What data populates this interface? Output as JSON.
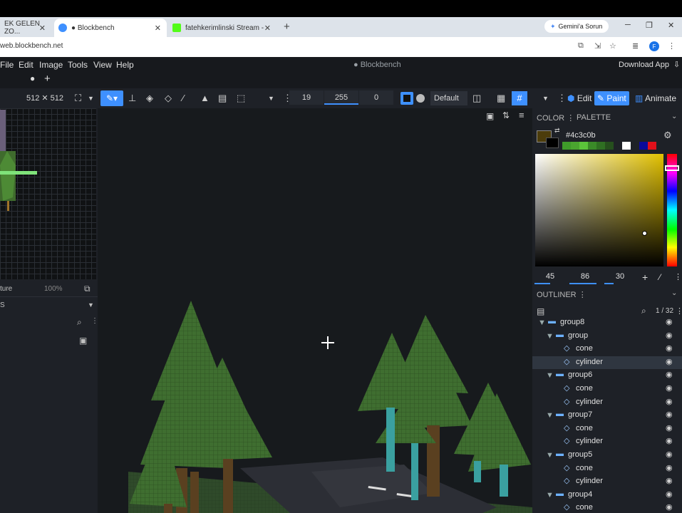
{
  "browser": {
    "tabs": [
      {
        "label": "EK GELEN ZO..."
      },
      {
        "label": "● Blockbench"
      },
      {
        "label": "fatehkerimlinski Stream - Watch"
      }
    ],
    "gemini_label": "Gemini'a Sorun",
    "url": "web.blockbench.net"
  },
  "app": {
    "menu": [
      "File",
      "Edit",
      "Image",
      "Tools",
      "View",
      "Help"
    ],
    "title": "● Blockbench",
    "download_label": "Download App"
  },
  "toolbar": {
    "texture_size": "512 ✕ 512",
    "brush_size": "19",
    "opacity": "255",
    "softness": "0",
    "blend_mode": "Default",
    "modes": [
      "Edit",
      "Paint",
      "Animate"
    ]
  },
  "left_panel": {
    "texture_label": "ture",
    "zoom": "100%",
    "section_label": "S"
  },
  "color_panel": {
    "tab_color": "COLOR",
    "tab_palette": "PALETTE",
    "hex": "#4c3c0b",
    "h": "45",
    "s": "86",
    "v": "30",
    "current_color": "#4c3c0b"
  },
  "outliner": {
    "title": "OUTLINER",
    "count": "1 / 32",
    "rows": [
      {
        "label": "group8",
        "type": "group",
        "indent": 0
      },
      {
        "label": "group",
        "type": "group",
        "indent": 1
      },
      {
        "label": "cone",
        "type": "mesh",
        "indent": 2
      },
      {
        "label": "cylinder",
        "type": "mesh",
        "indent": 2,
        "selected": true
      },
      {
        "label": "group6",
        "type": "group",
        "indent": 1
      },
      {
        "label": "cone",
        "type": "mesh",
        "indent": 2
      },
      {
        "label": "cylinder",
        "type": "mesh",
        "indent": 2
      },
      {
        "label": "group7",
        "type": "group",
        "indent": 1
      },
      {
        "label": "cone",
        "type": "mesh",
        "indent": 2
      },
      {
        "label": "cylinder",
        "type": "mesh",
        "indent": 2
      },
      {
        "label": "group5",
        "type": "group",
        "indent": 1
      },
      {
        "label": "cone",
        "type": "mesh",
        "indent": 2
      },
      {
        "label": "cylinder",
        "type": "mesh",
        "indent": 2
      },
      {
        "label": "group4",
        "type": "group",
        "indent": 1
      },
      {
        "label": "cone",
        "type": "mesh",
        "indent": 2
      }
    ]
  }
}
